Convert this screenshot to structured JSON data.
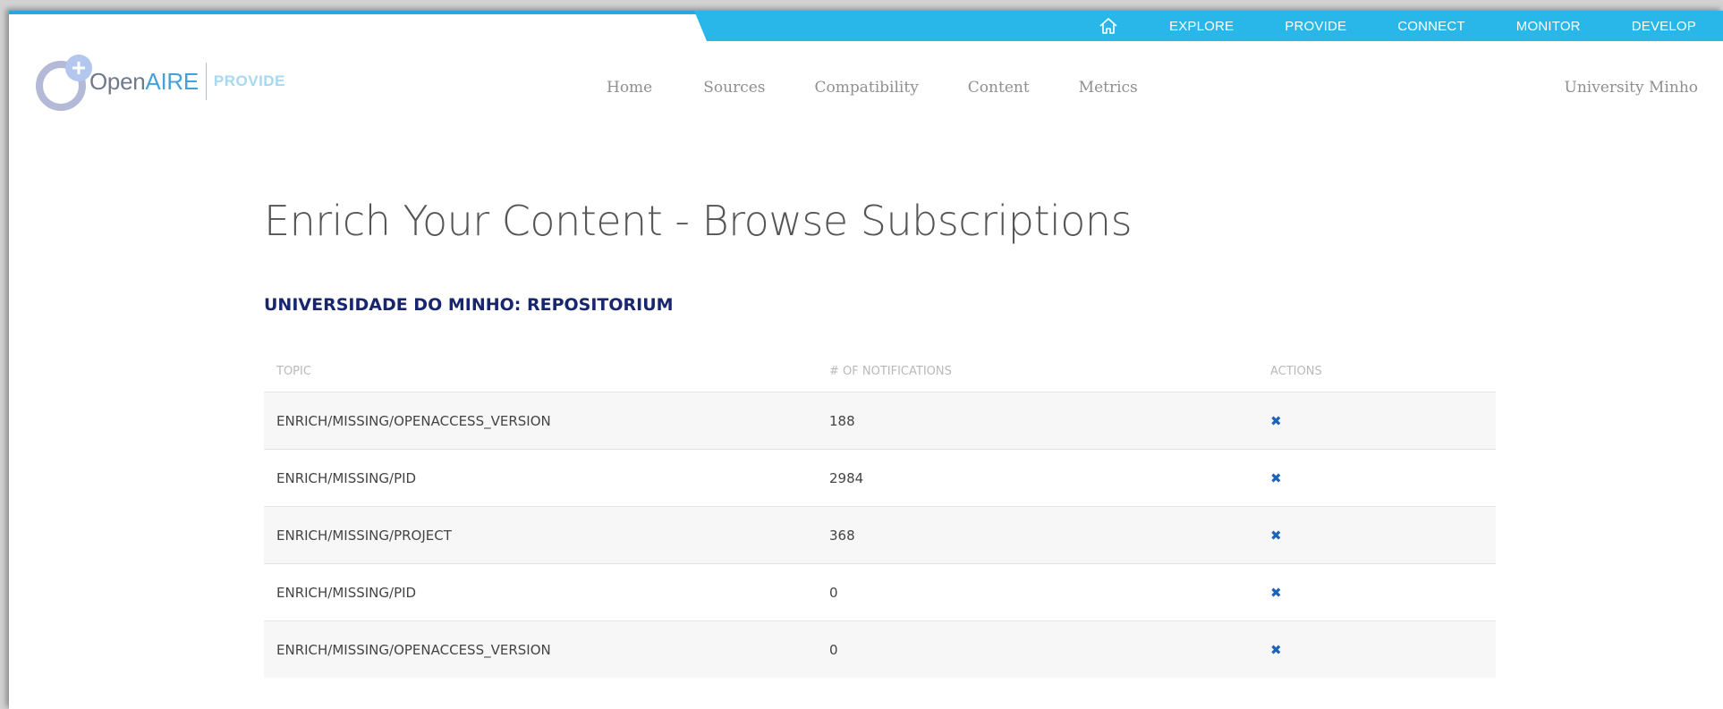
{
  "topbar": {
    "home_icon": "home-icon",
    "items": [
      "EXPLORE",
      "PROVIDE",
      "CONNECT",
      "MONITOR",
      "DEVELOP"
    ]
  },
  "logo": {
    "open": "Open",
    "aire": "AIRE",
    "provide": "PROVIDE"
  },
  "mainnav": {
    "items": [
      "Home",
      "Sources",
      "Compatibility",
      "Content",
      "Metrics"
    ],
    "user": "University Minho"
  },
  "page": {
    "title": "Enrich Your Content - Browse Subscriptions",
    "repository": "UNIVERSIDADE DO MINHO: REPOSITORIUM"
  },
  "table": {
    "headers": [
      "TOPIC",
      "# OF NOTIFICATIONS",
      "ACTIONS"
    ],
    "rows": [
      {
        "topic": "ENRICH/MISSING/OPENACCESS_VERSION",
        "count": "188",
        "action": "✖"
      },
      {
        "topic": "ENRICH/MISSING/PID",
        "count": "2984",
        "action": "✖"
      },
      {
        "topic": "ENRICH/MISSING/PROJECT",
        "count": "368",
        "action": "✖"
      },
      {
        "topic": "ENRICH/MISSING/PID",
        "count": "0",
        "action": "✖"
      },
      {
        "topic": "ENRICH/MISSING/OPENACCESS_VERSION",
        "count": "0",
        "action": "✖"
      }
    ]
  },
  "colors": {
    "topbar": "#29b7ea",
    "title": "#555555",
    "repository": "#17266e",
    "action": "#1f63b6"
  }
}
